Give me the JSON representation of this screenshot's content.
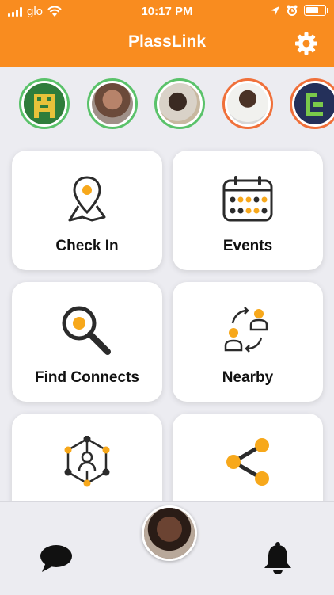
{
  "status_bar": {
    "carrier": "glo",
    "time": "10:17 PM"
  },
  "header": {
    "title": "PlassLink"
  },
  "stories": [
    {
      "name": "story-1",
      "ring": "green"
    },
    {
      "name": "story-2",
      "ring": "green"
    },
    {
      "name": "story-3",
      "ring": "green"
    },
    {
      "name": "story-4",
      "ring": "orange"
    },
    {
      "name": "story-5",
      "ring": "orange"
    }
  ],
  "tiles": {
    "check_in": "Check In",
    "events": "Events",
    "find_connects": "Find Connects",
    "nearby": "Nearby"
  },
  "colors": {
    "accent": "#f98c1f",
    "dot": "#f7a81b",
    "ring_green": "#5ac26a",
    "ring_orange": "#f0703a"
  }
}
